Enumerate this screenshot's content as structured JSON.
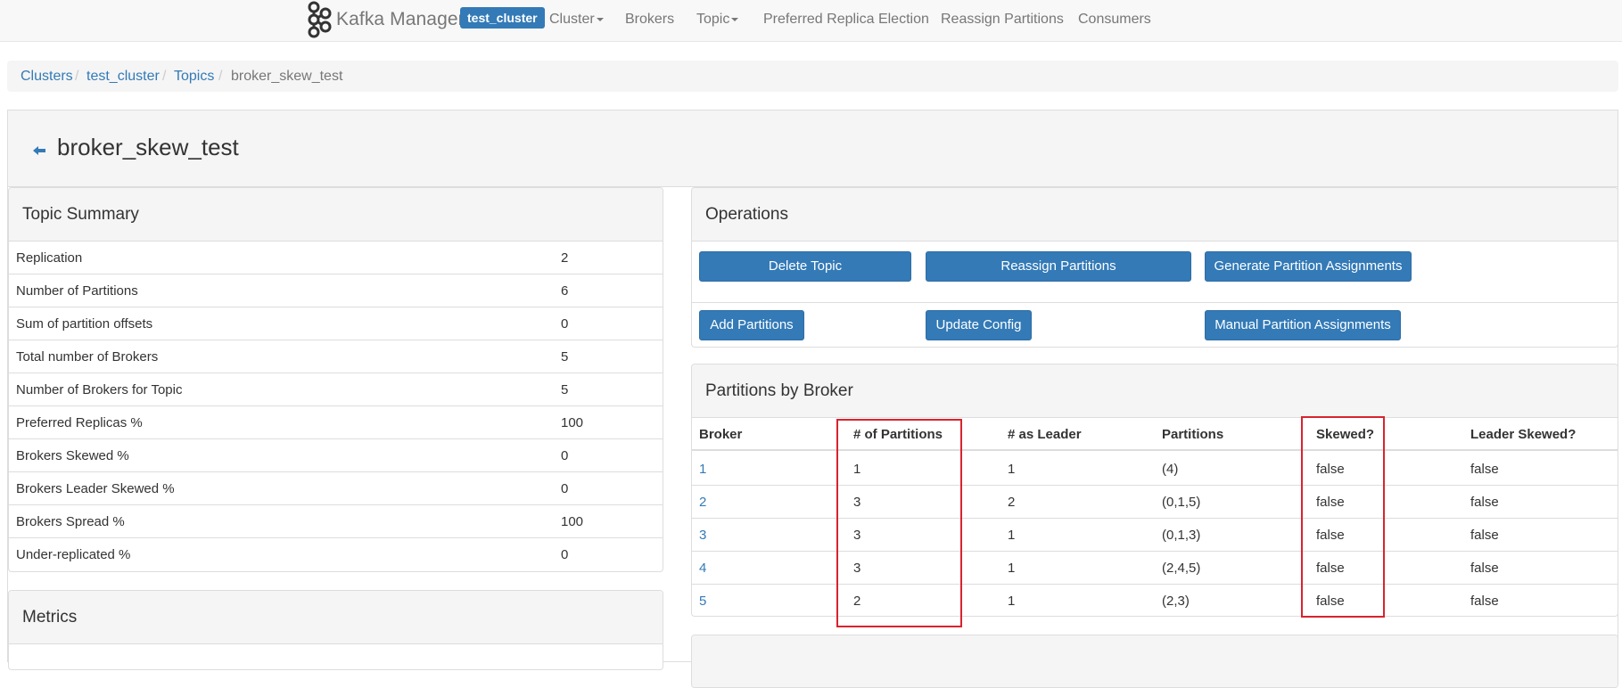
{
  "navbar": {
    "brand": "Kafka Manager",
    "cluster_badge": "test_cluster",
    "items": [
      "Cluster",
      "Brokers",
      "Topic",
      "Preferred Replica Election",
      "Reassign Partitions",
      "Consumers"
    ]
  },
  "breadcrumb": [
    "Clusters",
    "test_cluster",
    "Topics",
    "broker_skew_test"
  ],
  "topic": {
    "title": "broker_skew_test"
  },
  "summary": {
    "title": "Topic Summary",
    "rows": [
      {
        "label": "Replication",
        "value": "2"
      },
      {
        "label": "Number of Partitions",
        "value": "6"
      },
      {
        "label": "Sum of partition offsets",
        "value": "0"
      },
      {
        "label": "Total number of Brokers",
        "value": "5"
      },
      {
        "label": "Number of Brokers for Topic",
        "value": "5"
      },
      {
        "label": "Preferred Replicas %",
        "value": "100"
      },
      {
        "label": "Brokers Skewed %",
        "value": "0"
      },
      {
        "label": "Brokers Leader Skewed %",
        "value": "0"
      },
      {
        "label": "Brokers Spread %",
        "value": "100"
      },
      {
        "label": "Under-replicated %",
        "value": "0"
      }
    ]
  },
  "metrics": {
    "title": "Metrics"
  },
  "operations": {
    "title": "Operations",
    "buttons": {
      "delete_topic": "Delete Topic",
      "reassign_partitions": "Reassign Partitions",
      "generate_assignments": "Generate Partition Assignments",
      "add_partitions": "Add Partitions",
      "update_config": "Update Config",
      "manual_assignments": "Manual Partition Assignments"
    }
  },
  "partitions_by_broker": {
    "title": "Partitions by Broker",
    "columns": [
      "Broker",
      "# of Partitions",
      "# as Leader",
      "Partitions",
      "Skewed?",
      "Leader Skewed?"
    ],
    "rows": [
      [
        "1",
        "1",
        "1",
        "(4)",
        "false",
        "false"
      ],
      [
        "2",
        "3",
        "2",
        "(0,1,5)",
        "false",
        "false"
      ],
      [
        "3",
        "3",
        "1",
        "(0,1,3)",
        "false",
        "false"
      ],
      [
        "4",
        "3",
        "1",
        "(2,4,5)",
        "false",
        "false"
      ],
      [
        "5",
        "2",
        "1",
        "(2,3)",
        "false",
        "false"
      ]
    ]
  },
  "colors": {
    "primary": "#337ab7",
    "highlight": "#d9232d"
  }
}
